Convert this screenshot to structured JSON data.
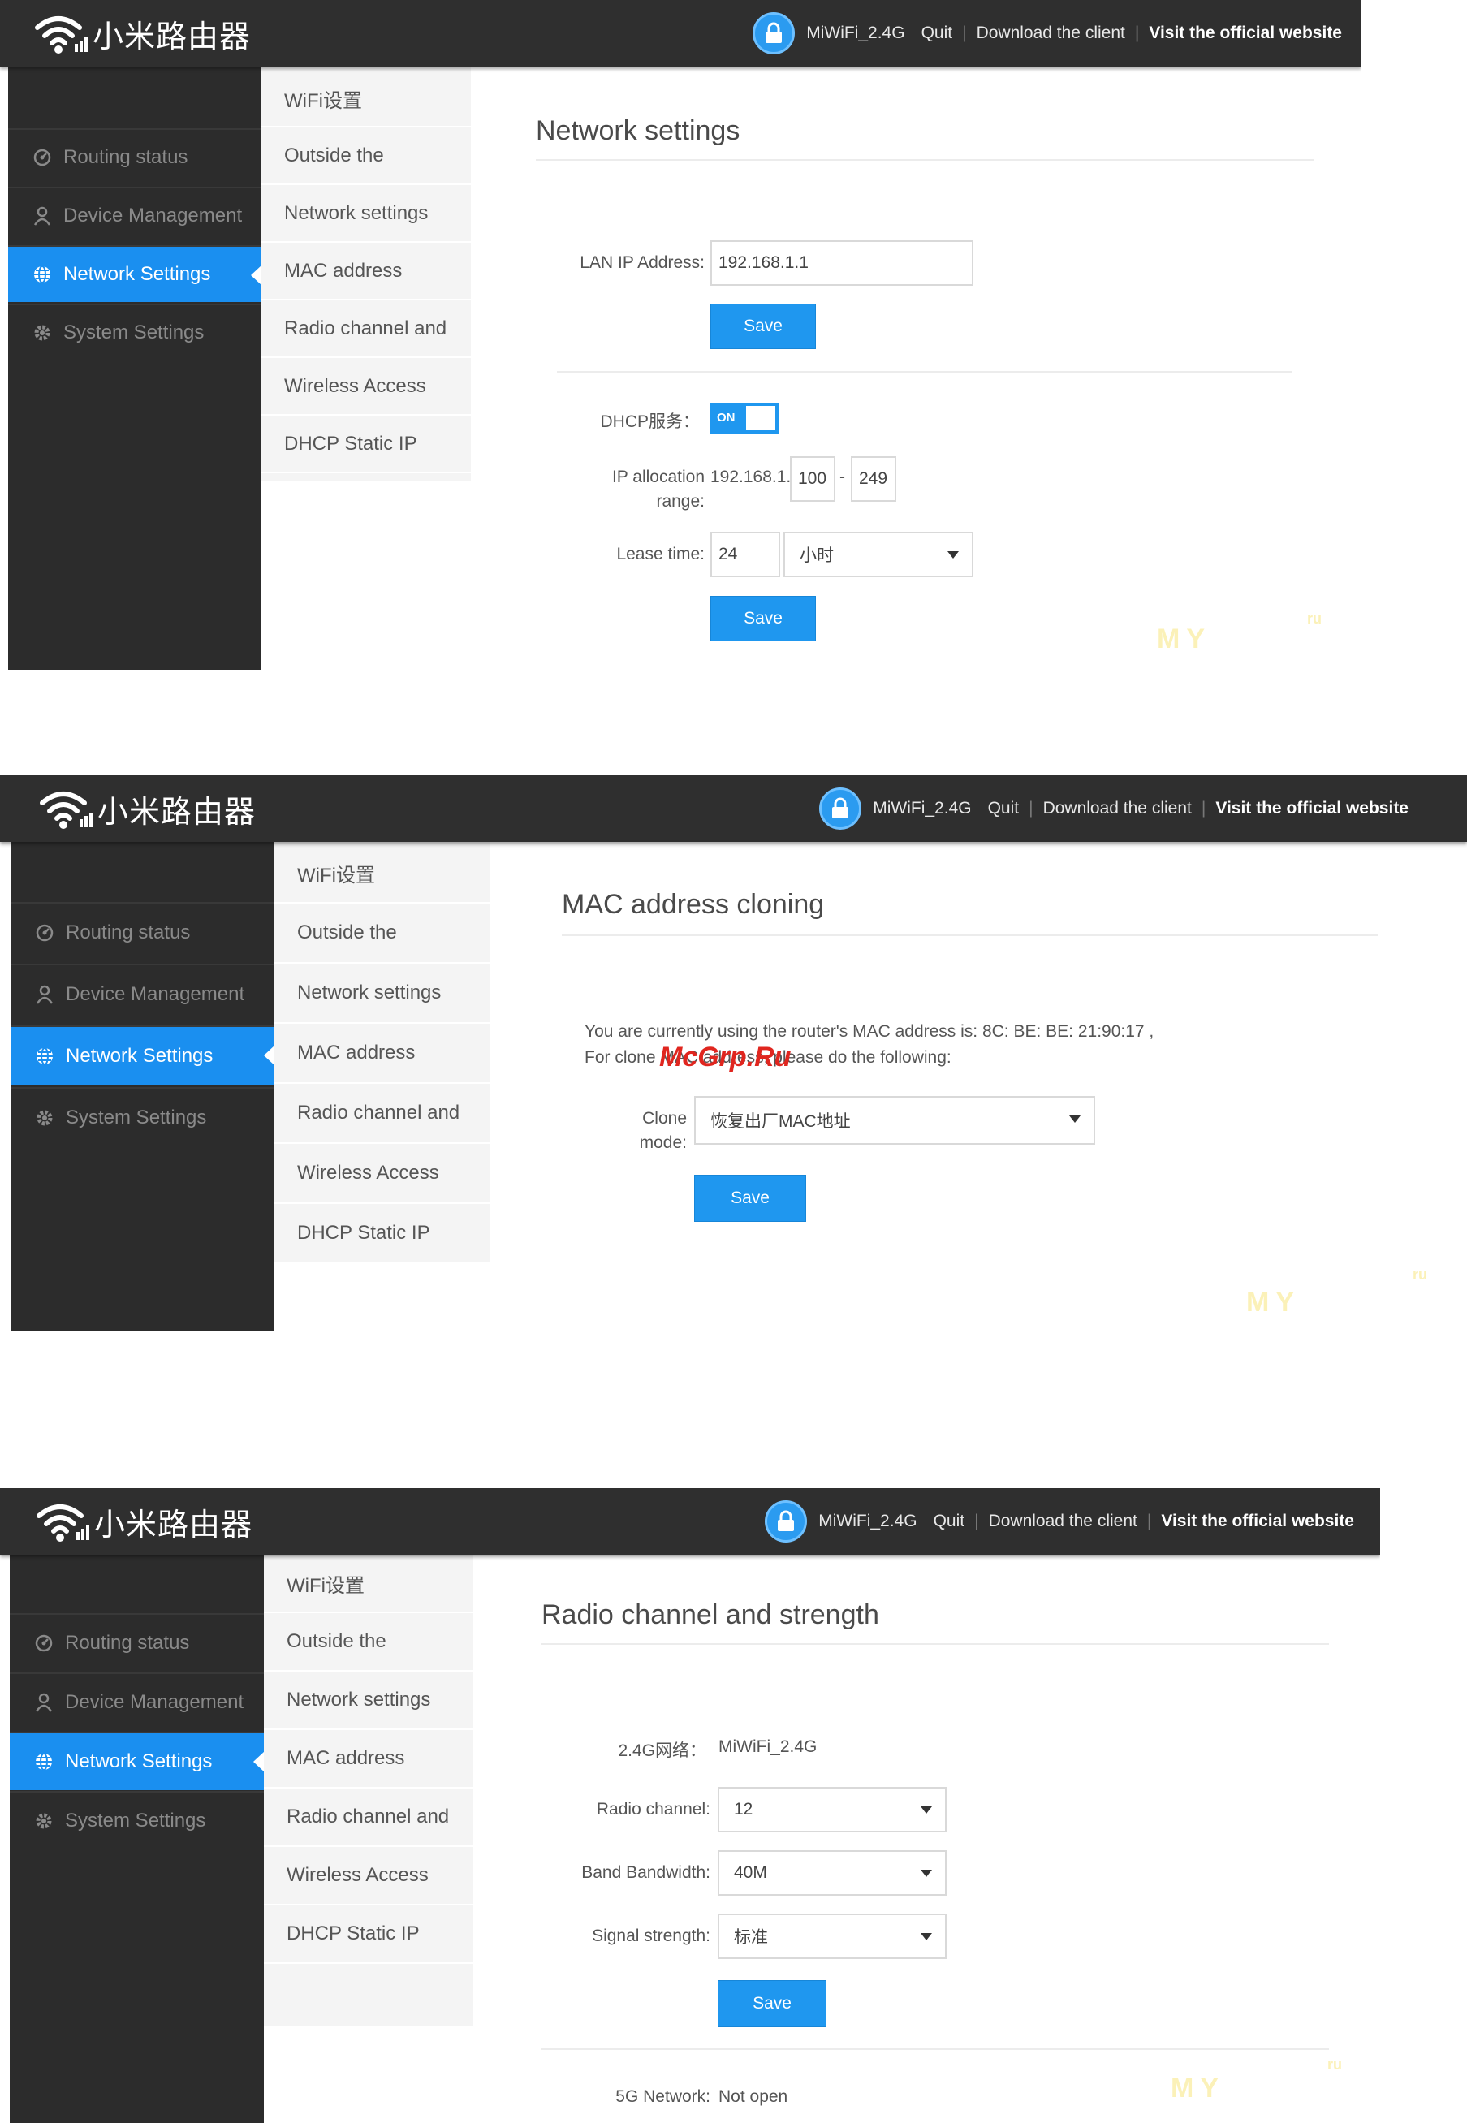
{
  "header": {
    "logo_text": "小米路由器",
    "wifi_name": "MiWiFi_2.4G",
    "quit": "Quit",
    "download": "Download the client",
    "official": "Visit the official website"
  },
  "sidebar": {
    "items": [
      {
        "label": "Routing status",
        "icon": "routing-status-icon"
      },
      {
        "label": "Device Management",
        "icon": "user-icon"
      },
      {
        "label": "Network Settings",
        "icon": "globe-icon"
      },
      {
        "label": "System Settings",
        "icon": "gear-icon"
      }
    ]
  },
  "subnav": {
    "items": [
      "WiFi设置",
      "Outside the",
      "Network settings",
      "MAC address",
      "Radio channel and",
      "Wireless Access",
      "DHCP Static IP"
    ]
  },
  "panel1": {
    "title": "Network settings",
    "lan_label": "LAN IP Address:",
    "lan_value": "192.168.1.1",
    "save": "Save",
    "dhcp_label": "DHCP服务：",
    "toggle_on": "ON",
    "range_label": "IP allocation range:",
    "range_prefix": "192.168.1.",
    "range_start": "100",
    "range_dash": "-",
    "range_end": "249",
    "lease_label": "Lease time:",
    "lease_value": "24",
    "lease_unit": "小时",
    "save2": "Save"
  },
  "panel2": {
    "title": "MAC address cloning",
    "info_line1": "You are currently using the router's MAC address is: 8C: BE: BE: 21:90:17 ,",
    "info_line2": "For clone MAC address, please do the following:",
    "clone_label": "Clone mode:",
    "clone_value": "恢复出厂MAC地址",
    "save": "Save"
  },
  "panel3": {
    "title": "Radio channel and strength",
    "network_label": "2.4G网络：",
    "network_value": "MiWiFi_2.4G",
    "channel_label": "Radio channel:",
    "channel_value": "12",
    "bandwidth_label": "Band Bandwidth:",
    "bandwidth_value": "40M",
    "signal_label": "Signal strength:",
    "signal_value": "标准",
    "save": "Save",
    "net5g_label": "5G Network:",
    "net5g_value": "Not open"
  },
  "watermark": "McGrp.Ru",
  "colors": {
    "accent": "#1f97ef",
    "topbar": "#2f2f2f",
    "sidebar": "#2c2c2c",
    "subnav": "#f4f4f4"
  }
}
